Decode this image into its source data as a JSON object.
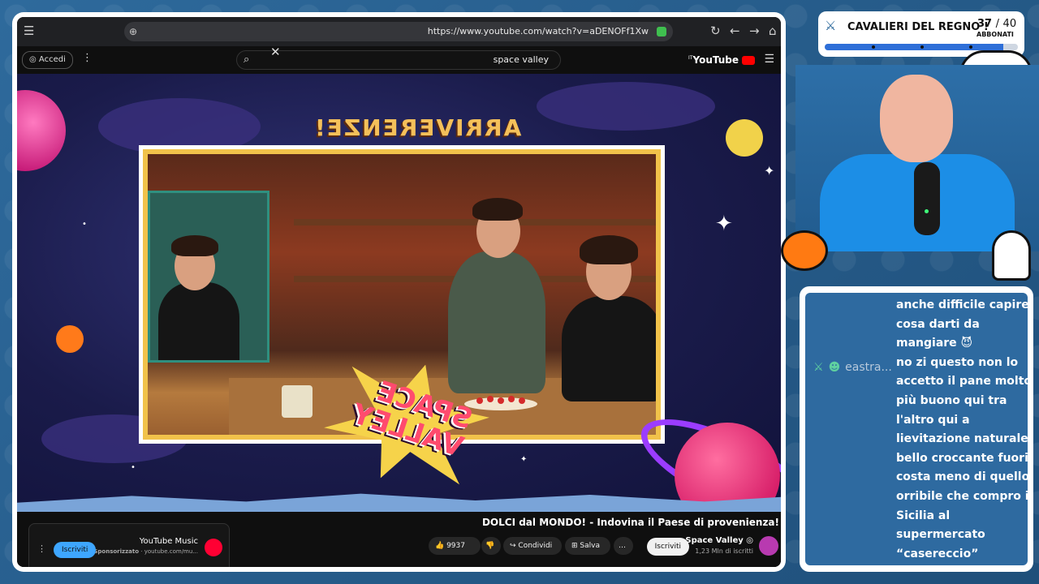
{
  "browser": {
    "url": "https://www.youtube.com/watch?v=aDENOFf1Xw",
    "icons": [
      "menu-icon",
      "zoom-icon",
      "reload-icon",
      "back-icon",
      "forward-icon",
      "home-icon",
      "shield-icon"
    ]
  },
  "youtube": {
    "logo_text": "YouTube",
    "logo_suffix": "IT",
    "search_value": "space valley",
    "accedi_label": "Accedi",
    "video_title": "DOLCI dal MONDO! - Indovina il Paese di provenienza!",
    "channel_name": "Space Valley",
    "subscribers": "1,23 Mln di iscritti",
    "subscribe_label": "Iscriviti",
    "like_count": "9937",
    "share_label": "Condividi",
    "save_label": "Salva",
    "ad": {
      "name": "YouTube Music",
      "sponsored": "Sponsorizzato",
      "domain": "youtube.com/mu...",
      "subscribe_label": "Iscriviti"
    }
  },
  "video": {
    "banner_text": "ARRIVERENZE!",
    "logo_line1": "SPACE",
    "logo_line2": "VALLEY"
  },
  "goal": {
    "title": "CAVALIERI DEL REGNO !",
    "current": "37",
    "separator": "/",
    "target": "40",
    "unit": "ABBONATI",
    "progress": 0.925,
    "icon": "sword-icon"
  },
  "chat": {
    "username": "eastra...",
    "message_lines": [
      "anche difficile capire",
      "cosa darti da",
      "mangiare 😈",
      "no zi questo non lo",
      "accetto il pane molto",
      "più buono qui tra",
      "l'altro qui a",
      "lievitazione naturale",
      "bello croccante fuori",
      "costa meno di quello",
      "orribile che compro in",
      "Sicilia al",
      "supermercato",
      "“casereccio”"
    ]
  },
  "colors": {
    "accent": "#2e6fd8",
    "yt_red": "#ff0000",
    "chat_bg": "#2e6aa0"
  }
}
